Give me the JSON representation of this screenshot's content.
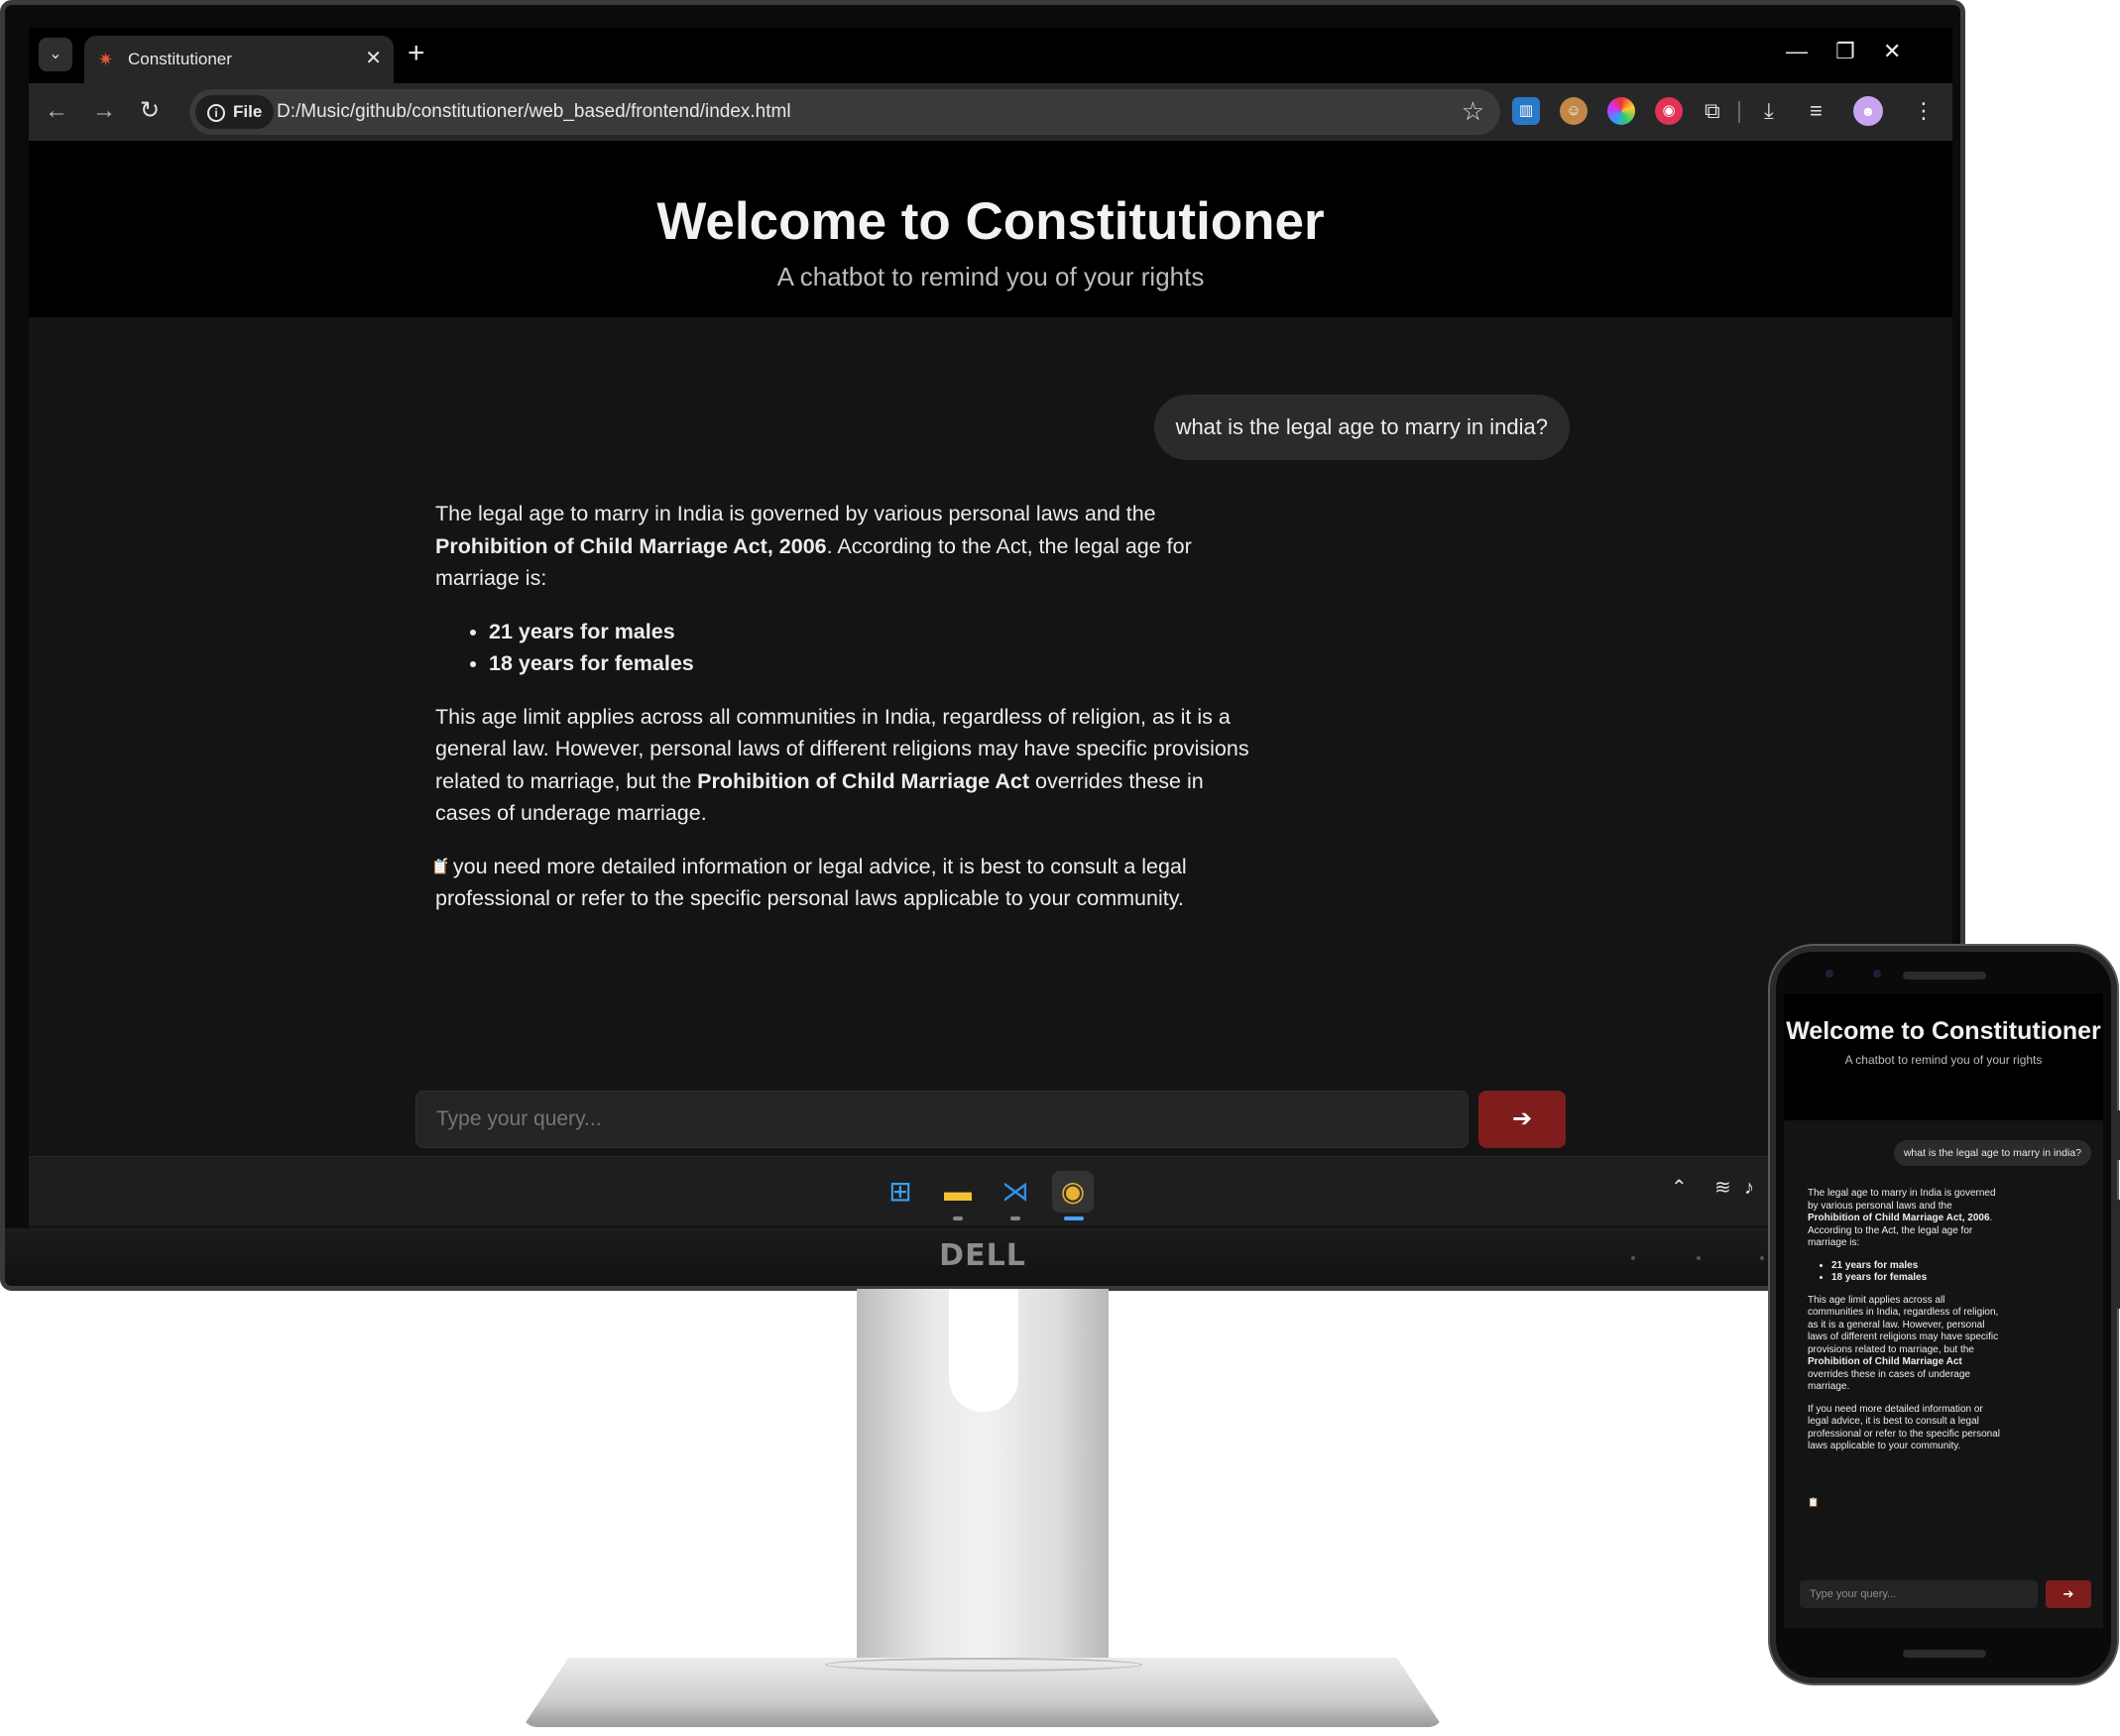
{
  "browser": {
    "tab_title": "Constitutioner",
    "tab_favicon": "✷",
    "url": "D:/Music/github/constitutioner/web_based/frontend/index.html",
    "file_chip_label": "File",
    "icons": [
      "tab-search-icon",
      "close-icon",
      "new-tab-icon",
      "minimize-icon",
      "restore-icon",
      "back-icon",
      "forward-icon",
      "reload-icon",
      "info-icon",
      "bookmark-star-icon",
      "extension-icon",
      "download-icon",
      "media-control-icon",
      "menu-icon"
    ]
  },
  "page": {
    "title": "Welcome to Constitutioner",
    "subtitle": "A chatbot to remind you of your rights",
    "user_message": "what is the legal age to marry in india?",
    "bot": {
      "p1_a": "The legal age to marry in India is governed by various personal laws and the",
      "p1_bold": "Prohibition of Child Marriage Act, 2006",
      "p1_b": ". According to the Act, the legal age for marriage is:",
      "list": [
        "21 years for males",
        "18 years for females"
      ],
      "p2_a": "This age limit applies across all communities in India, regardless of religion, as it is a general law. However, personal laws of different religions may have specific provisions related to marriage, but the",
      "p2_bold": "Prohibition of Child Marriage Act",
      "p2_b": "overrides these in cases of underage marriage.",
      "p3": "If you need more detailed information or legal advice, it is best to consult a legal professional or refer to the specific personal laws applicable to your community."
    },
    "input_placeholder": "Type your query...",
    "send_label": "➔"
  },
  "monitor": {
    "brand": "DELL"
  },
  "colors": {
    "send_button": "#7f1d1d",
    "header_bg": "#000000",
    "page_bg": "#141414",
    "user_bubble": "#2b2b2b"
  }
}
